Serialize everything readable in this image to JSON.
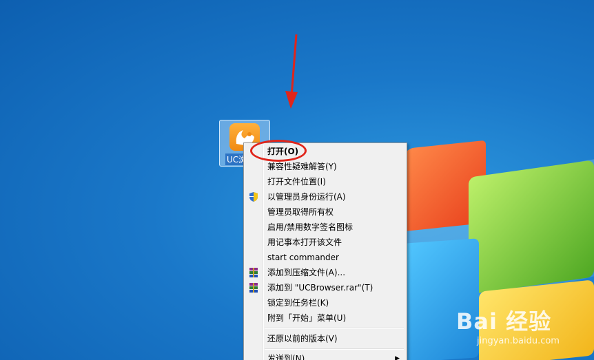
{
  "desktop": {
    "icon": {
      "label": "UC浏"
    }
  },
  "context_menu": {
    "items": [
      {
        "label": "打开(O)",
        "bold": true,
        "icon": ""
      },
      {
        "label": "兼容性疑难解答(Y)",
        "icon": ""
      },
      {
        "label": "打开文件位置(I)",
        "icon": ""
      },
      {
        "label": "以管理员身份运行(A)",
        "icon": "uac-shield-icon"
      },
      {
        "label": "管理员取得所有权",
        "icon": ""
      },
      {
        "label": "启用/禁用数字签名图标",
        "icon": ""
      },
      {
        "label": "用记事本打开该文件",
        "icon": ""
      },
      {
        "label": "start commander",
        "icon": ""
      },
      {
        "label": "添加到压缩文件(A)...",
        "icon": "winrar-icon"
      },
      {
        "label": "添加到 \"UCBrowser.rar\"(T)",
        "icon": "winrar-icon"
      },
      {
        "label": "锁定到任务栏(K)",
        "icon": ""
      },
      {
        "label": "附到「开始」菜单(U)",
        "icon": ""
      },
      {
        "label": "还原以前的版本(V)",
        "icon": ""
      },
      {
        "label": "发送到(N)",
        "icon": "",
        "submenu": true
      }
    ]
  },
  "watermark": {
    "logo": "Bai 经验",
    "url": "jingyan.baidu.com"
  },
  "colors": {
    "annotation_red": "#e0251b",
    "menu_bg": "#f0f0f0"
  }
}
